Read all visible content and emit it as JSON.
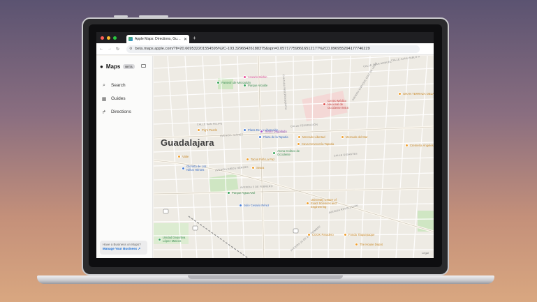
{
  "browser": {
    "tab_title": "Apple Maps: Directions, Guides",
    "url": "beta.maps.apple.com/?ll=20.669532201554595%2C-103.32965426188375&spn=0.057177598616512177%2C0.096955294177746229",
    "traffic_colors": [
      "#ff5f57",
      "#febc2e",
      "#28c840"
    ]
  },
  "sidebar": {
    "brand": "Maps",
    "beta_badge": "BETA",
    "items": [
      {
        "label": "Search",
        "icon": "search-icon"
      },
      {
        "label": "Guides",
        "icon": "grid-icon"
      },
      {
        "label": "Directions",
        "icon": "directions-icon"
      }
    ],
    "business_prompt": "Have a Business on Maps?",
    "business_link": "Manage Your Business ↗"
  },
  "map": {
    "city": "Guadalajara",
    "legal": "Legal",
    "pois": [
      {
        "label": "Acuario Michin",
        "color": "#e8519a",
        "text_color": "#d64a8f"
      },
      {
        "label": "Panteón de Mezquitán",
        "color": "#3aa55b",
        "text_color": "#3f8f56"
      },
      {
        "label": "Parque Alcalde",
        "color": "#3aa55b",
        "text_color": "#3f8f56"
      },
      {
        "label": "Centro Médico Nacional de Occidente IMSS",
        "color": "#e0524f",
        "text_color": "#c44a48"
      },
      {
        "label": "GRAN TERRAZA OBLATOS",
        "color": "#f0a030",
        "text_color": "#c98a2a"
      },
      {
        "label": "Pig's Pearls",
        "color": "#f0a030",
        "text_color": "#c98a2a"
      },
      {
        "label": "Plaza De La Liberación",
        "color": "#4a7fd8",
        "text_color": "#3a6ec8"
      },
      {
        "label": "Teatro Degollado",
        "color": "#a855c8",
        "text_color": "#9446b8"
      },
      {
        "label": "Plaza de la Tapatía",
        "color": "#4a7fd8",
        "text_color": "#3a6ec8"
      },
      {
        "label": "Mercado Libertad",
        "color": "#f0a030",
        "text_color": "#c98a2a"
      },
      {
        "label": "Mercado del Mar",
        "color": "#f0a030",
        "text_color": "#c98a2a"
      },
      {
        "label": "Cava Cervecería Tapatía",
        "color": "#f0a030",
        "text_color": "#c98a2a"
      },
      {
        "label": "Arena Coliseo de Occidente",
        "color": "#3aa55b",
        "text_color": "#3f8f56"
      },
      {
        "label": "Tacos Fish La Paz",
        "color": "#f0a030",
        "text_color": "#c98a2a"
      },
      {
        "label": "Viale",
        "color": "#f0a030",
        "text_color": "#c98a2a"
      },
      {
        "label": "Glorieta de Los Niños Héroes",
        "color": "#4a7fd8",
        "text_color": "#3a6ec8"
      },
      {
        "label": "Seara",
        "color": "#f0a030",
        "text_color": "#c98a2a"
      },
      {
        "label": "Parque Agua Azul",
        "color": "#3aa55b",
        "text_color": "#3f8f56"
      },
      {
        "label": "Julio Cesario Pérez",
        "color": "#4a7fd8",
        "text_color": "#3a6ec8"
      },
      {
        "label": "University Center of Exact Sciences and Engineering",
        "color": "#f0a030",
        "text_color": "#c98a2a"
      },
      {
        "label": "Unidad Deportiva López Mateos",
        "color": "#3aa55b",
        "text_color": "#3f8f56"
      },
      {
        "label": "COOK Paradero",
        "color": "#f0a030",
        "text_color": "#c98a2a"
      },
      {
        "label": "Fonda Tlaquepaque",
        "color": "#f0a030",
        "text_color": "#c98a2a"
      },
      {
        "label": "The House Depot",
        "color": "#f0a030",
        "text_color": "#c98a2a"
      },
      {
        "label": "Cremería Ángeles",
        "color": "#f0a030",
        "text_color": "#c98a2a"
      }
    ],
    "streets": [
      "CALLE JUAN MANUEL",
      "AVENIDA JUÁREZ",
      "AVENIDA REVOLUCIÓN",
      "CALZADA INDEPENDENCIA",
      "CALLE SAN FELIPE",
      "AVENIDA 5 DE FEBRERO",
      "CALLE GIGANTES",
      "AVENIDA NIÑOS HÉROES",
      "AVENIDA ENRIQUE DÍAZ DE LEÓN",
      "CALLE FEDERACIÓN",
      "AVENIDA 16 DE SEPTIEMBRE",
      "CALLE JUAN PABLO II"
    ]
  }
}
